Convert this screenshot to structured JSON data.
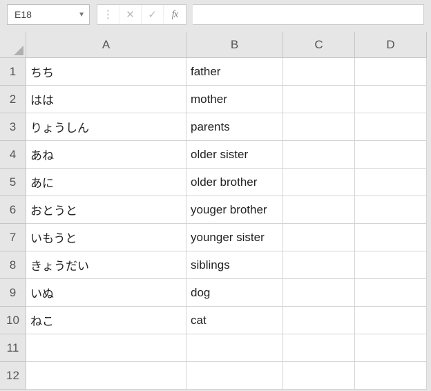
{
  "name_box": {
    "value": "E18"
  },
  "fx_label": "fx",
  "columns": [
    {
      "key": "A",
      "label": "A",
      "class": "col-A"
    },
    {
      "key": "B",
      "label": "B",
      "class": "col-B"
    },
    {
      "key": "C",
      "label": "C",
      "class": "col-C"
    },
    {
      "key": "D",
      "label": "D",
      "class": "col-D"
    }
  ],
  "rows": [
    {
      "n": "1",
      "A": "ちち",
      "B": "father",
      "C": "",
      "D": ""
    },
    {
      "n": "2",
      "A": "はは",
      "B": "mother",
      "C": "",
      "D": ""
    },
    {
      "n": "3",
      "A": "りょうしん",
      "B": "parents",
      "C": "",
      "D": ""
    },
    {
      "n": "4",
      "A": "あね",
      "B": "older sister",
      "C": "",
      "D": ""
    },
    {
      "n": "5",
      "A": "あに",
      "B": "older brother",
      "C": "",
      "D": ""
    },
    {
      "n": "6",
      "A": "おとうと",
      "B": "youger brother",
      "C": "",
      "D": ""
    },
    {
      "n": "7",
      "A": "いもうと",
      "B": "younger sister",
      "C": "",
      "D": ""
    },
    {
      "n": "8",
      "A": "きょうだい",
      "B": "siblings",
      "C": "",
      "D": ""
    },
    {
      "n": "9",
      "A": "いぬ",
      "B": "dog",
      "C": "",
      "D": ""
    },
    {
      "n": "10",
      "A": "ねこ",
      "B": "cat",
      "C": "",
      "D": ""
    },
    {
      "n": "11",
      "A": "",
      "B": "",
      "C": "",
      "D": ""
    },
    {
      "n": "12",
      "A": "",
      "B": "",
      "C": "",
      "D": ""
    }
  ]
}
